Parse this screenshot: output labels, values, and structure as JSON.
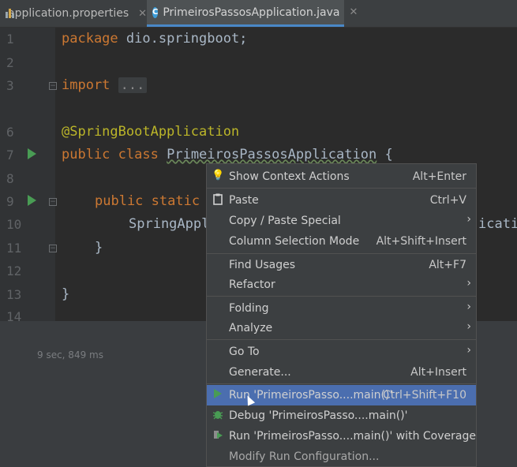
{
  "tabs": [
    {
      "label": "application.properties",
      "close": "✕"
    },
    {
      "label": "PrimeirosPassosApplication.java",
      "close": "✕"
    }
  ],
  "editor": {
    "line_numbers": [
      "1",
      "2",
      "3",
      "6",
      "7",
      "8",
      "9",
      "10",
      "11",
      "12",
      "13",
      "14"
    ],
    "line1": {
      "kw": "package",
      "rest": " dio.springboot;"
    },
    "line3": {
      "kw": "import",
      "dots": "..."
    },
    "line6": "@SpringBootApplication",
    "line7": {
      "kw1": "public",
      "kw2": "class",
      "name": "PrimeirosPassosApplication",
      "brace": " {"
    },
    "line9": {
      "kw1": "public",
      "kw2": "static"
    },
    "line10": {
      "left": "SpringAppl",
      "right": "icati"
    },
    "line11": "}",
    "line13": "}"
  },
  "run_timer": "9 sec, 849 ms",
  "context_menu": {
    "items": [
      {
        "label": "Show Context Actions",
        "shortcut": "Alt+Enter",
        "icon": "lightbulb-icon"
      },
      {
        "label": "Paste",
        "shortcut": "Ctrl+V",
        "icon": "clipboard-icon"
      },
      {
        "label": "Copy / Paste Special",
        "submenu": true
      },
      {
        "label": "Column Selection Mode",
        "shortcut": "Alt+Shift+Insert"
      },
      {
        "label": "Find Usages",
        "shortcut": "Alt+F7"
      },
      {
        "label": "Refactor",
        "submenu": true
      },
      {
        "label": "Folding",
        "submenu": true
      },
      {
        "label": "Analyze",
        "submenu": true
      },
      {
        "label": "Go To",
        "submenu": true
      },
      {
        "label": "Generate...",
        "shortcut": "Alt+Insert"
      },
      {
        "label": "Run 'PrimeirosPasso....main()'",
        "shortcut": "Ctrl+Shift+F10",
        "icon": "run-icon",
        "selected": true
      },
      {
        "label": "Debug 'PrimeirosPasso....main()'",
        "icon": "debug-icon"
      },
      {
        "label": "Run 'PrimeirosPasso....main()' with Coverage",
        "icon": "coverage-icon"
      },
      {
        "label": "Modify Run Configuration...",
        "dim": true
      }
    ]
  },
  "colors": {
    "accent": "#4b6eaf",
    "run_green": "#499c54",
    "keyword": "#cc7832",
    "annotation": "#bbb529"
  }
}
